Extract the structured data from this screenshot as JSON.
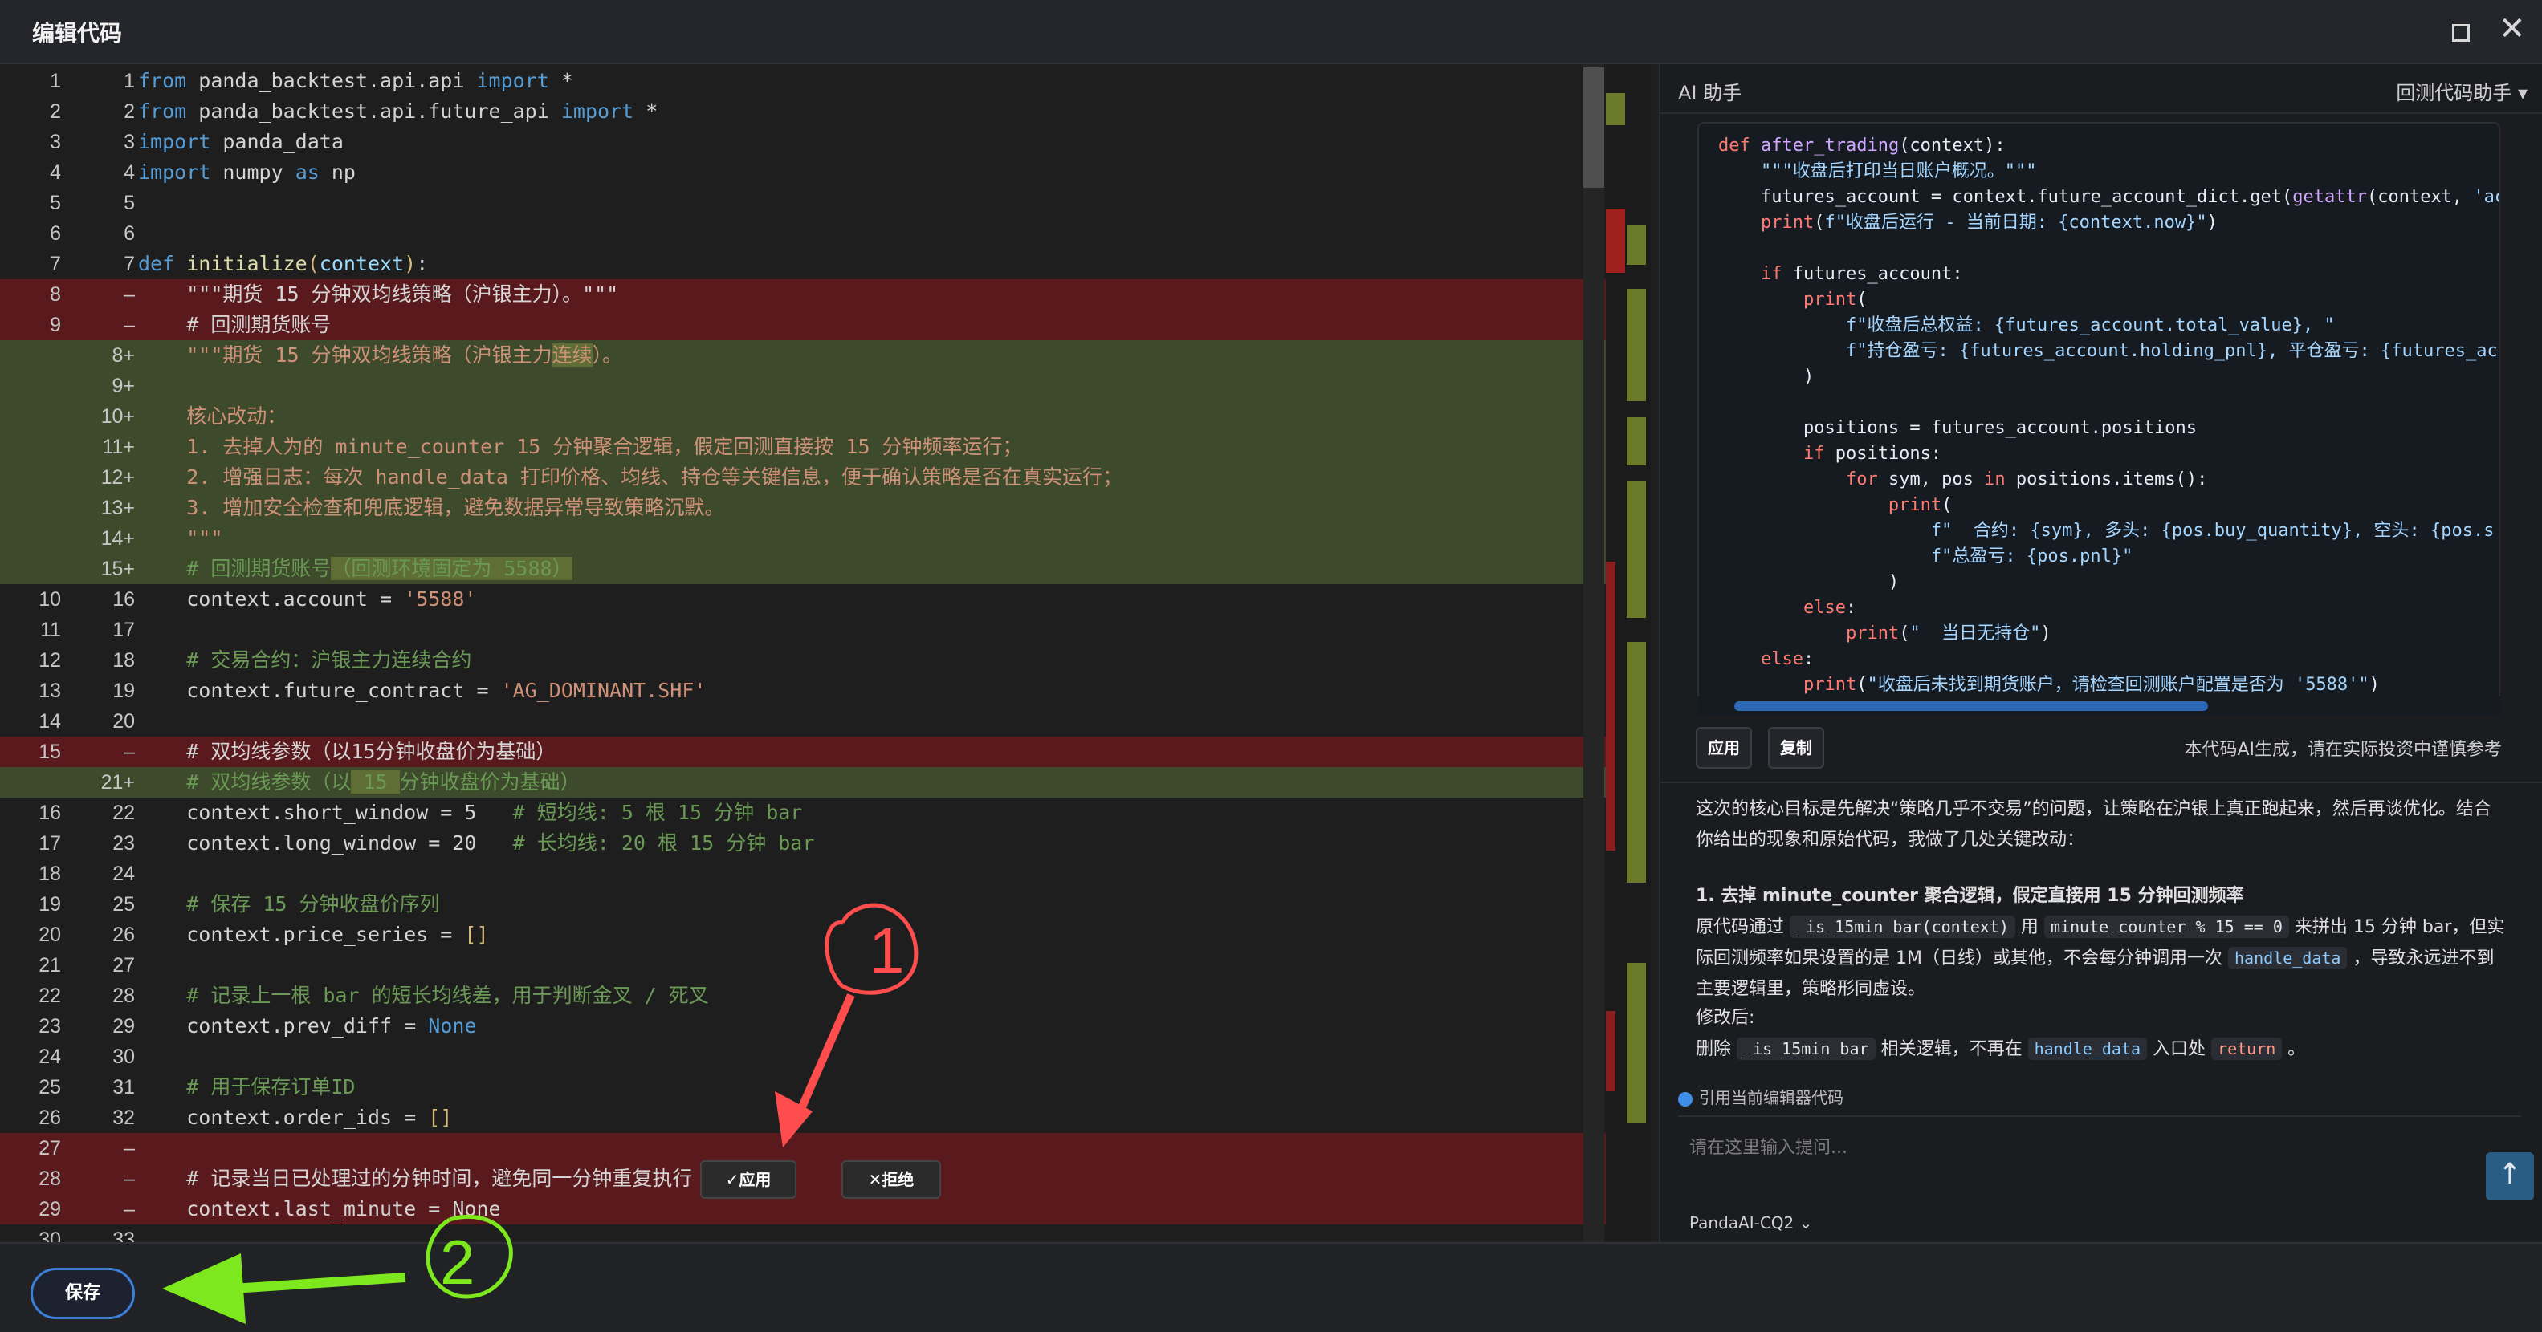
{
  "dialog": {
    "title": "编辑代码"
  },
  "editor": {
    "lines": [
      {
        "o": "1",
        "n": "1",
        "t": "",
        "html": "<span class='k'>from</span> <span class='w'>panda_backtest.api.api</span> <span class='k'>import</span> <span class='w'>*</span>"
      },
      {
        "o": "2",
        "n": "2",
        "t": "",
        "html": "<span class='k'>from</span> <span class='w'>panda_backtest.api.future_api</span> <span class='k'>import</span> <span class='w'>*</span>"
      },
      {
        "o": "3",
        "n": "3",
        "t": "",
        "html": "<span class='k'>import</span> <span class='w'>panda_data</span>"
      },
      {
        "o": "4",
        "n": "4",
        "t": "",
        "html": "<span class='k'>import</span> <span class='w'>numpy</span> <span class='k'>as</span> <span class='w'>np</span>"
      },
      {
        "o": "5",
        "n": "5",
        "t": "",
        "html": ""
      },
      {
        "o": "6",
        "n": "6",
        "t": "",
        "html": ""
      },
      {
        "o": "7",
        "n": "7",
        "t": "",
        "html": "<span class='k'>def</span> <span class='f'>initialize</span><span class='y'>(</span><span class='n'>context</span><span class='y'>)</span><span class='w'>:</span>"
      },
      {
        "o": "8",
        "n": "–",
        "t": "del",
        "html": "    <span class='w'>\"\"\"期货 15 分钟双均线策略（沪银主力）。\"\"\"</span>"
      },
      {
        "o": "9",
        "n": "–",
        "t": "del",
        "html": "    <span class='w'># 回测期货账号</span>"
      },
      {
        "o": "",
        "n": "8+",
        "t": "add",
        "html": "    <span class='s'>\"\"\"期货 15 分钟双均线策略（沪银主力<span class='hl'>连续</span>）。</span>"
      },
      {
        "o": "",
        "n": "9+",
        "t": "add",
        "html": ""
      },
      {
        "o": "",
        "n": "10+",
        "t": "add",
        "html": "    <span class='s'>核心改动：</span>"
      },
      {
        "o": "",
        "n": "11+",
        "t": "add",
        "html": "    <span class='s'>1. 去掉人为的 minute_counter 15 分钟聚合逻辑，假定回测直接按 15 分钟频率运行；</span>"
      },
      {
        "o": "",
        "n": "12+",
        "t": "add",
        "html": "    <span class='s'>2. 增强日志：每次 handle_data 打印价格、均线、持仓等关键信息，便于确认策略是否在真实运行；</span>"
      },
      {
        "o": "",
        "n": "13+",
        "t": "add",
        "html": "    <span class='s'>3. 增加安全检查和兜底逻辑，避免数据异常导致策略沉默。</span>"
      },
      {
        "o": "",
        "n": "14+",
        "t": "add",
        "html": "    <span class='s'>\"\"\"</span>"
      },
      {
        "o": "",
        "n": "15+",
        "t": "add",
        "html": "    <span class='c'># 回测期货账号<span class='hl'>（回测环境固定为 5588）</span></span>"
      },
      {
        "o": "10",
        "n": "16",
        "t": "",
        "html": "    <span class='w'>context.account = </span><span class='s'>'5588'</span>"
      },
      {
        "o": "11",
        "n": "17",
        "t": "",
        "html": ""
      },
      {
        "o": "12",
        "n": "18",
        "t": "",
        "html": "    <span class='c'># 交易合约：沪银主力连续合约</span>"
      },
      {
        "o": "13",
        "n": "19",
        "t": "",
        "html": "    <span class='w'>context.future_contract = </span><span class='s'>'AG_DOMINANT.SHF'</span>"
      },
      {
        "o": "14",
        "n": "20",
        "t": "",
        "html": ""
      },
      {
        "o": "15",
        "n": "–",
        "t": "del",
        "html": "    <span class='w'># 双均线参数（以15分钟收盘价为基础）</span>"
      },
      {
        "o": "",
        "n": "21+",
        "t": "add",
        "html": "    <span class='c'># 双均线参数（以<span class='hl'> 15 </span>分钟收盘价为基础）</span>"
      },
      {
        "o": "16",
        "n": "22",
        "t": "",
        "html": "    <span class='w'>context.short_window = </span><span class='w'>5</span>   <span class='c'># 短均线: 5 根 15 分钟 bar</span>"
      },
      {
        "o": "17",
        "n": "23",
        "t": "",
        "html": "    <span class='w'>context.long_window = </span><span class='w'>20</span>   <span class='c'># 长均线: 20 根 15 分钟 bar</span>"
      },
      {
        "o": "18",
        "n": "24",
        "t": "",
        "html": ""
      },
      {
        "o": "19",
        "n": "25",
        "t": "",
        "html": "    <span class='c'># 保存 15 分钟收盘价序列</span>"
      },
      {
        "o": "20",
        "n": "26",
        "t": "",
        "html": "    <span class='w'>context.price_series = </span><span class='y'>[]</span>"
      },
      {
        "o": "21",
        "n": "27",
        "t": "",
        "html": ""
      },
      {
        "o": "22",
        "n": "28",
        "t": "",
        "html": "    <span class='c'># 记录上一根 bar 的短长均线差，用于判断金叉 / 死叉</span>"
      },
      {
        "o": "23",
        "n": "29",
        "t": "",
        "html": "    <span class='w'>context.prev_diff = </span><span class='k'>None</span>"
      },
      {
        "o": "24",
        "n": "30",
        "t": "",
        "html": ""
      },
      {
        "o": "25",
        "n": "31",
        "t": "",
        "html": "    <span class='c'># 用于保存订单ID</span>"
      },
      {
        "o": "26",
        "n": "32",
        "t": "",
        "html": "    <span class='w'>context.order_ids = </span><span class='y'>[]</span>"
      },
      {
        "o": "27",
        "n": "–",
        "t": "del",
        "html": ""
      },
      {
        "o": "28",
        "n": "–",
        "t": "del",
        "html": "    <span class='w'># 记录当日已处理过的分钟时间，避免同一分钟重复执行</span>"
      },
      {
        "o": "29",
        "n": "–",
        "t": "del",
        "html": "    <span class='w'>context.last_minute = None</span>"
      },
      {
        "o": "30",
        "n": "33",
        "t": "",
        "html": ""
      }
    ],
    "apply_label": "✓应用",
    "reject_label": "✕拒绝"
  },
  "assistant": {
    "title": "AI 助手",
    "mode": "回测代码助手 ▾",
    "code_lines": [
      "<span class='p'>def</span> <span class='u'>after_trading</span>(context):",
      "    <span class='q'>\"\"\"收盘后打印当日账户概况。\"\"\"</span>",
      "    futures_account = context.future_account_dict.get(<span class='u'>getattr</span>(context, <span class='q'>'ac</span>",
      "    <span class='p'>print</span>(<span class='q'>f\"收盘后运行 - 当前日期: {context.now}\"</span>)",
      "",
      "    <span class='p'>if</span> futures_account:",
      "        <span class='p'>print</span>(",
      "            <span class='q'>f\"收盘后总权益: {futures_account.total_value}, \"</span>",
      "            <span class='q'>f\"持仓盈亏: {futures_account.holding_pnl}, 平仓盈亏: {futures_ac</span>",
      "        )",
      "",
      "        positions = futures_account.positions",
      "        <span class='p'>if</span> positions:",
      "            <span class='p'>for</span> sym, pos <span class='p'>in</span> positions.items():",
      "                <span class='p'>print</span>(",
      "                    <span class='q'>f\"  合约: {sym}, 多头: {pos.buy_quantity}, 空头: {pos.s</span>",
      "                    <span class='q'>f\"总盈亏: {pos.pnl}\"</span>",
      "                )",
      "        <span class='p'>else</span>:",
      "            <span class='p'>print</span>(<span class='q'>\"  当日无持仓\"</span>)",
      "    <span class='p'>else</span>:",
      "        <span class='p'>print</span>(<span class='q'>\"收盘后未找到期货账户，请检查回测账户配置是否为 '5588'\"</span>)"
    ],
    "apply_label": "应用",
    "copy_label": "复制",
    "disclaimer": "本代码AI生成，请在实际投资中谨慎参考",
    "intro": "这次的核心目标是先解决“策略几乎不交易”的问题，让策略在沪银上真正跑起来，然后再谈优化。结合你给出的现象和原始代码，我做了几处关键改动：",
    "point1_title": "1. 去掉 minute_counter 聚合逻辑，假定直接用 15 分钟回测频率",
    "point1_a": "原代码通过",
    "point1_code1": "_is_15min_bar(context)",
    "point1_b": "用",
    "point1_code2": "minute_counter % 15 == 0",
    "point1_c": "来拼出 15 分钟 bar，但实际回测频率如果设置的是 1M（日线）或其他，不会每分钟调用一次",
    "point1_code3": "handle_data",
    "point1_d": "，导致永远进不到主要逻辑里，策略形同虚设。",
    "after_label": "修改后:",
    "del_a": "删除",
    "del_code1": "_is_15min_bar",
    "del_b": "相关逻辑，不再在",
    "del_code2": "handle_data",
    "del_c": "入口处",
    "del_code3": "return",
    "del_d": "。",
    "quote_label": "引用当前编辑器代码",
    "input_placeholder": "请在这里输入提问...",
    "model": "PandaAI-CQ2 ⌄",
    "send_icon": "↑"
  },
  "footer": {
    "save_label": "保存"
  },
  "annotations": {
    "one": "1",
    "two": "2"
  },
  "colors": {
    "deleted": "#5a1a1d",
    "added": "#3d4a2b",
    "accent": "#3d7ed9",
    "annotation_red": "#ff4d4d",
    "annotation_green": "#7ee81e"
  }
}
